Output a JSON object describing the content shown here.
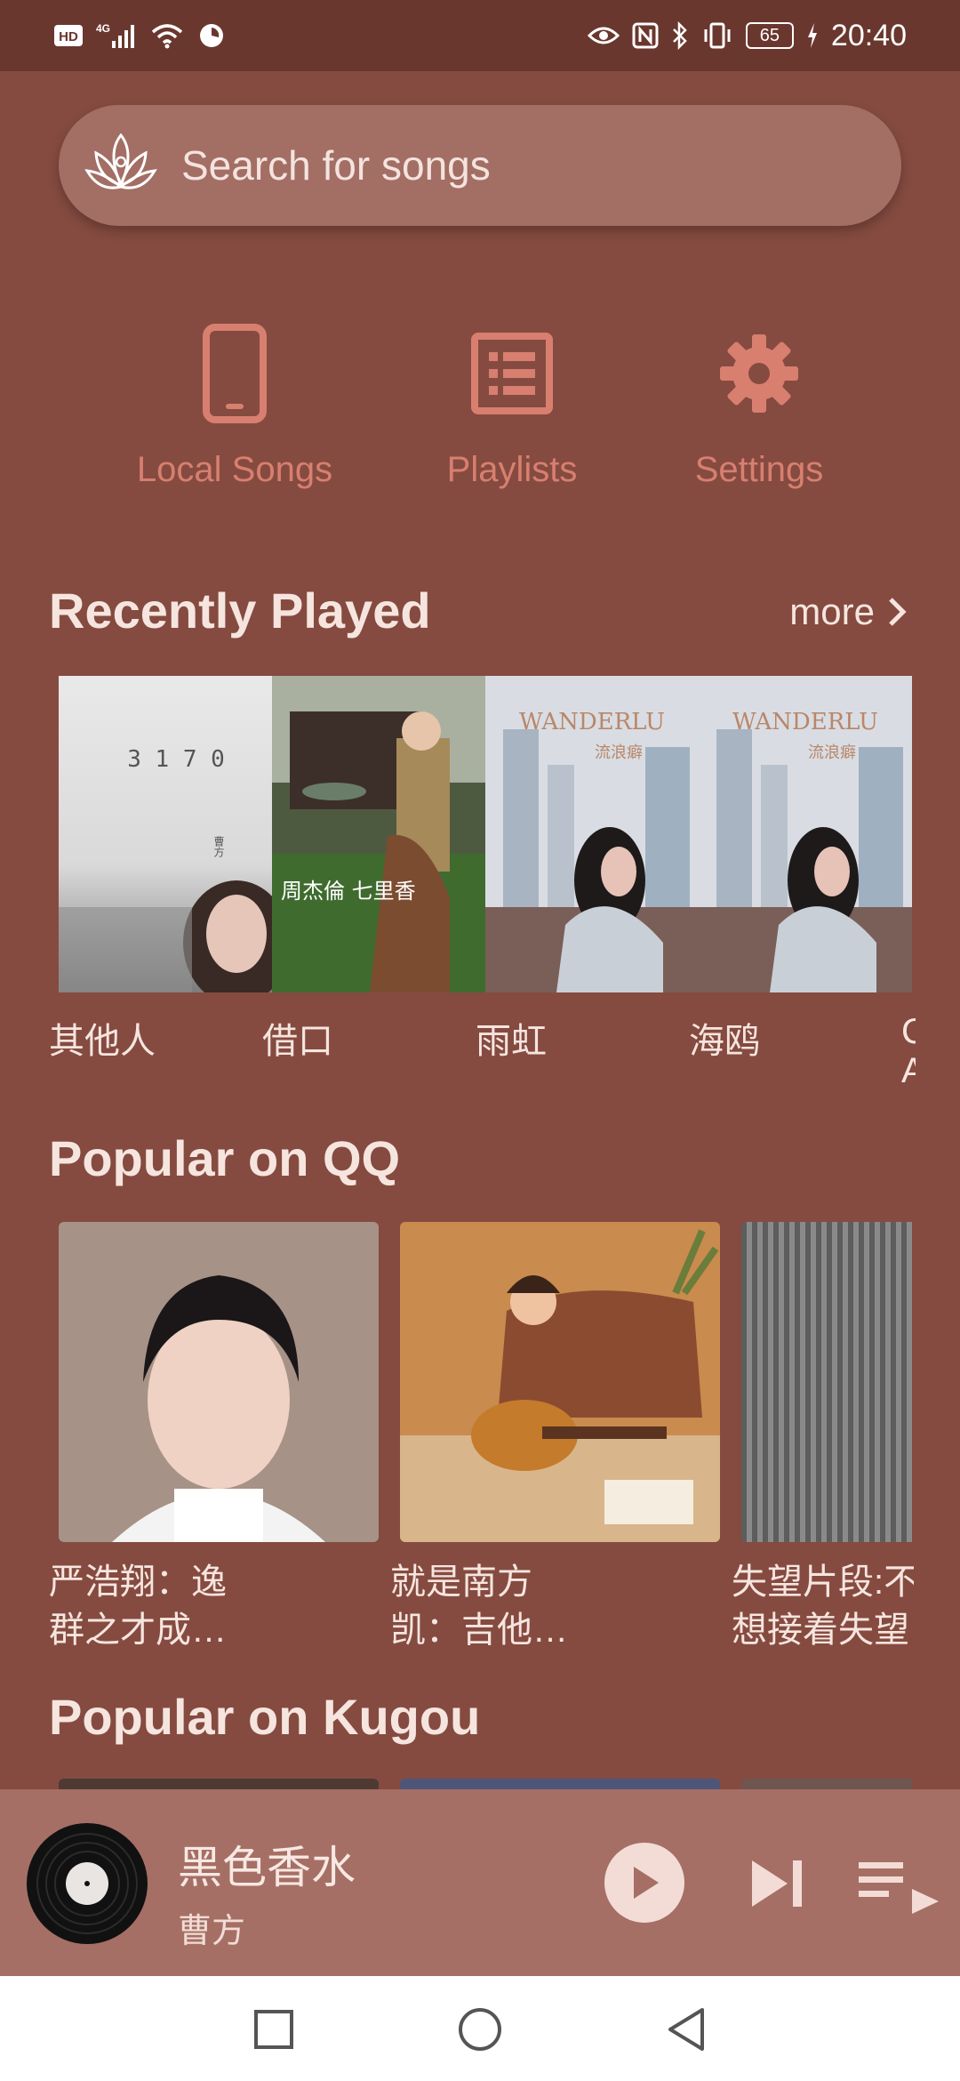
{
  "status_bar": {
    "left_icons": [
      "hd-icon",
      "4g-signal-icon",
      "wifi-icon",
      "sync-icon"
    ],
    "hd_text": "HD",
    "network_text": "4G",
    "right_icons": [
      "eye-icon",
      "nfc-icon",
      "bluetooth-icon",
      "vibrate-icon"
    ],
    "battery": "65",
    "time": "20:40"
  },
  "search": {
    "placeholder": "Search for songs",
    "logo_icon": "lotus-logo-icon"
  },
  "quick_actions": [
    {
      "label": "Local Songs",
      "icon": "phone-icon"
    },
    {
      "label": "Playlists",
      "icon": "list-icon"
    },
    {
      "label": "Settings",
      "icon": "gear-icon"
    }
  ],
  "recently_played": {
    "title": "Recently Played",
    "more_label": "more",
    "items": [
      {
        "title": "其他人",
        "cover_text": "3 1 7 0",
        "cover_sub": "曹方"
      },
      {
        "title": "借口",
        "cover_text": "周杰倫 七里香"
      },
      {
        "title": "雨虹",
        "cover_text": "WANDERLU",
        "cover_sub": "流浪癖"
      },
      {
        "title": "海鸥",
        "cover_text": "WANDERLU",
        "cover_sub": "流浪癖"
      }
    ],
    "partial_label": "C A"
  },
  "popular_qq": {
    "title": "Popular on QQ",
    "items": [
      {
        "line1": "严浩翔：逸",
        "line2": "群之才成…"
      },
      {
        "line1": "就是南方",
        "line2": "凯：吉他…"
      },
      {
        "line1": "失望片段:不",
        "line2": "想接着失望"
      }
    ]
  },
  "popular_kugou": {
    "title": "Popular on Kugou"
  },
  "now_playing": {
    "title": "黑色香水",
    "artist": "曹方"
  },
  "colors": {
    "background": "#854b40",
    "accent": "#d87f70",
    "status_bar": "#6a372e",
    "player_bar": "#a56f65"
  }
}
